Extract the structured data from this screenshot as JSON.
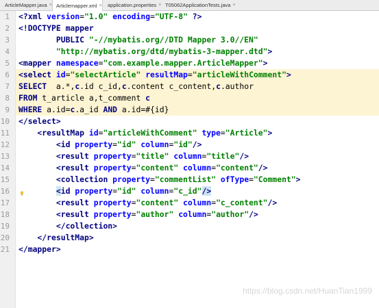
{
  "tabs": [
    {
      "label": "ArticleMapper.java",
      "icon": "java-class-icon",
      "active": false
    },
    {
      "label": "Articlemapper.xml",
      "icon": "xml-file-icon",
      "active": true
    },
    {
      "label": "application.properties",
      "icon": "properties-file-icon",
      "active": false
    },
    {
      "label": "T05062ApplicationTests.java",
      "icon": "java-test-icon",
      "active": false
    }
  ],
  "gutter": {
    "line_numbers": [
      "1",
      "2",
      "3",
      "4",
      "5",
      "6",
      "7",
      "8",
      "9",
      "10",
      "11",
      "12",
      "13",
      "14",
      "15",
      "16",
      "17",
      "18",
      "19",
      "20",
      "21"
    ],
    "intention_icon": "lightbulb-icon"
  },
  "code_lines": [
    "<?xml version=\"1.0\" encoding=\"UTF-8\" ?>",
    "<!DOCTYPE mapper",
    "        PUBLIC \"-//mybatis.org//DTD Mapper 3.0//EN\"",
    "        \"http://mybatis.org/dtd/mybatis-3-mapper.dtd\">",
    "<mapper namespace=\"com.example.mapper.ArticleMapper\">",
    "<select id=\"selectArticle\" resultMap=\"articleWithComment\">",
    "SELECT  a.*,c.id c_id,c.content c_content,c.author",
    "FROM t_article a,t_comment c",
    "WHERE a.id=c.a_id AND a.id=#{id}",
    "</select>",
    "    <resultMap id=\"articleWithComment\" type=\"Article\">",
    "        <id property=\"id\" column=\"id\"/>",
    "        <result property=\"title\" column=\"title\"/>",
    "        <result property=\"content\" column=\"content\"/>",
    "        <collection property=\"commentList\" ofType=\"Comment\">",
    "        <id property=\"id\" column=\"c_id\"/>",
    "        <result property=\"content\" column=\"c_content\"/>",
    "        <result property=\"author\" column=\"author\"/>",
    "        </collection>",
    "    </resultMap>",
    "</mapper>"
  ],
  "highlighted_lines": [
    6,
    7,
    8,
    9
  ],
  "watermark": "https://blog.csdn.net/HuanTian1999",
  "colors": {
    "tag": "#000080",
    "attribute": "#0000ff",
    "string": "#008000",
    "sql_highlight_bg": "#fdf4d3",
    "gutter_bg": "#f0f0f0"
  }
}
